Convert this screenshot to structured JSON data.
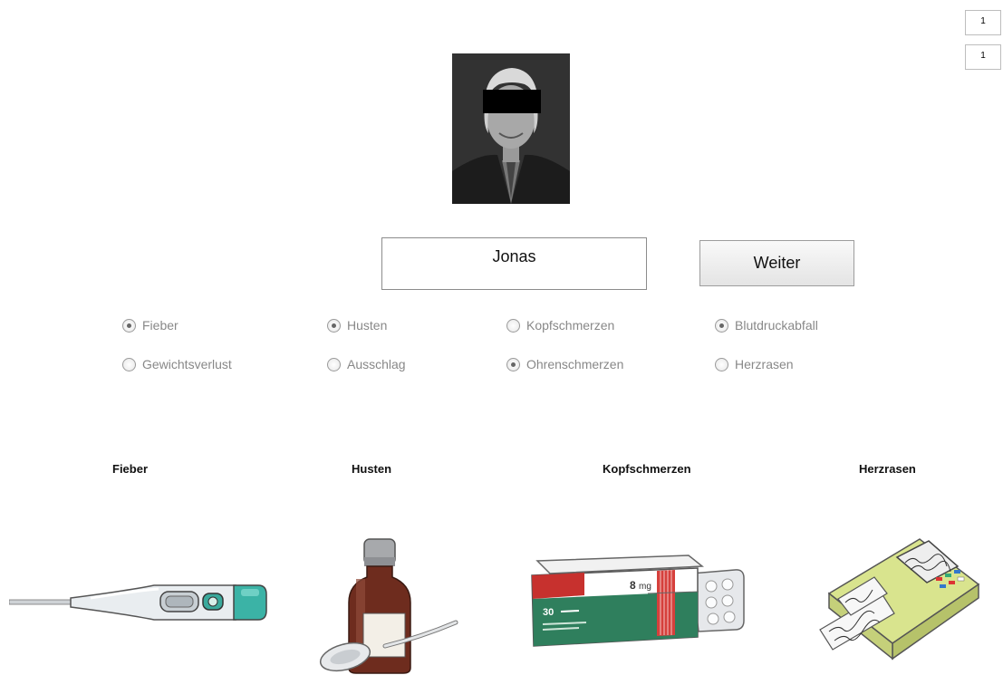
{
  "counters": [
    "1",
    "1"
  ],
  "person": {
    "name": "Jonas"
  },
  "next_label": "Weiter",
  "symptoms": [
    {
      "label": "Fieber",
      "checked": true
    },
    {
      "label": "Husten",
      "checked": true
    },
    {
      "label": "Kopfschmerzen",
      "checked": false
    },
    {
      "label": "Blutdruckabfall",
      "checked": true
    },
    {
      "label": "Gewichtsverlust",
      "checked": false
    },
    {
      "label": "Ausschlag",
      "checked": false
    },
    {
      "label": "Ohrenschmerzen",
      "checked": true
    },
    {
      "label": "Herzrasen",
      "checked": false
    }
  ],
  "categories": [
    "Fieber",
    "Husten",
    "Kopfschmerzen",
    "Herzrasen"
  ],
  "pill_box": {
    "count": "30",
    "dose": "8",
    "unit": "mg"
  }
}
